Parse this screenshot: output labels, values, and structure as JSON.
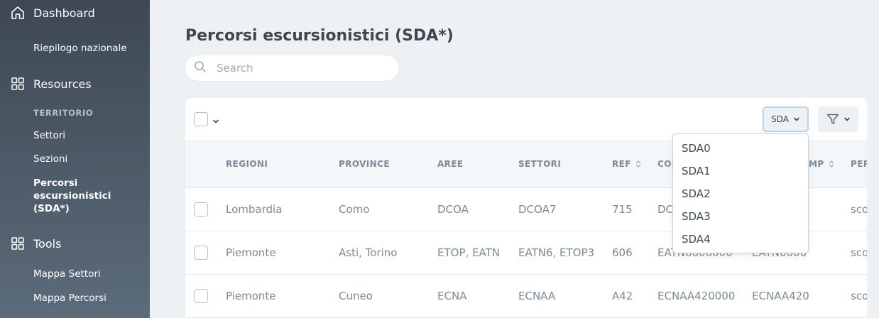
{
  "sidebar": {
    "dashboard_label": "Dashboard",
    "riepilogo_label": "Riepilogo nazionale",
    "resources_label": "Resources",
    "territorio_group": "TERRITORIO",
    "settori_label": "Settori",
    "sezioni_label": "Sezioni",
    "percorsi_label": "Percorsi escursionistici (SDA*)",
    "tools_label": "Tools",
    "mappa_settori_label": "Mappa Settori",
    "mappa_percorsi_label": "Mappa Percorsi"
  },
  "main": {
    "title": "Percorsi escursionistici (SDA*)",
    "search_placeholder": "Search"
  },
  "toolbar": {
    "sda_label": "SDA"
  },
  "table": {
    "headers": [
      "REGIONI",
      "PROVINCE",
      "AREE",
      "SETTORI",
      "REF",
      "CODICE",
      "CODICE SDA COMP",
      "PERCORSO"
    ],
    "header_visible": {
      "regioni": "REGIONI",
      "province": "PROVINCE",
      "aree": "AREE",
      "settori": "SETTORI",
      "ref": "REF",
      "cod": "COD",
      "mp": "MP",
      "per": "PER"
    },
    "rows": [
      {
        "regioni": "Lombardia",
        "province": "Como",
        "aree": "DCOA",
        "settori": "DCOA7",
        "ref": "715",
        "codice": "DC",
        "sda": "",
        "percorso": "sco"
      },
      {
        "regioni": "Piemonte",
        "province": "Asti, Torino",
        "aree": "ETOP, EATN",
        "settori": "EATN6, ETOP3",
        "ref": "606",
        "codice": "EATN6606000",
        "sda": "EATN6606",
        "percorso": "sco"
      },
      {
        "regioni": "Piemonte",
        "province": "Cuneo",
        "aree": "ECNA",
        "settori": "ECNAA",
        "ref": "A42",
        "codice": "ECNAA420000",
        "sda": "ECNAA420",
        "percorso": "sco"
      }
    ]
  },
  "dropdown": {
    "options": [
      "SDA0",
      "SDA1",
      "SDA2",
      "SDA3",
      "SDA4"
    ]
  },
  "colors": {
    "sidebar_top": "#3d4852",
    "sidebar_bottom": "#5c6b7a",
    "page_bg": "#eef1f4",
    "accent_border": "#b7d3ee"
  }
}
